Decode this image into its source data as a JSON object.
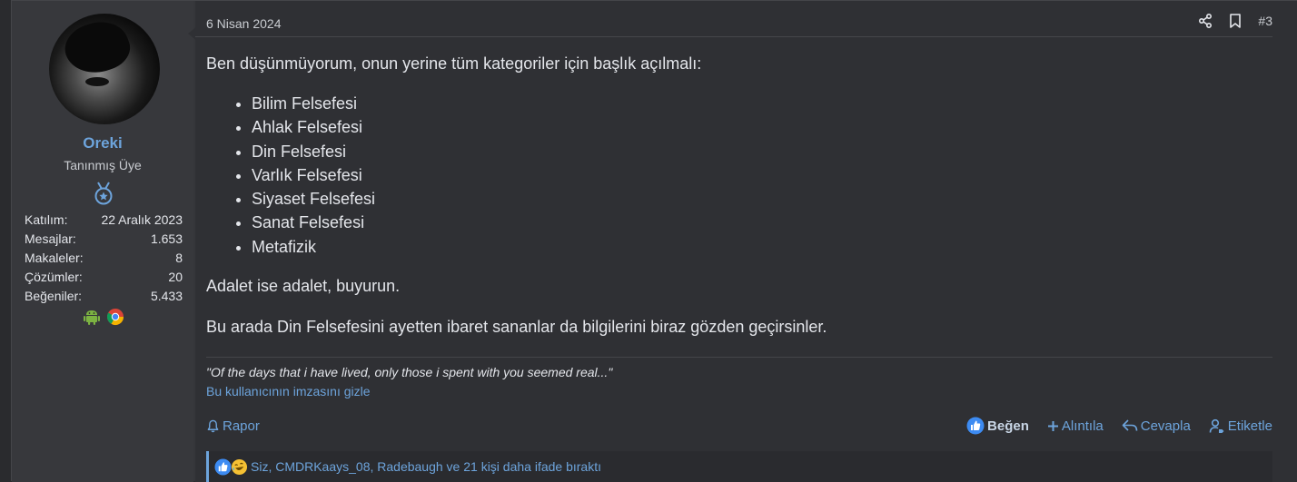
{
  "user": {
    "name": "Oreki",
    "title": "Tanınmış Üye",
    "stats": [
      {
        "label": "Katılım:",
        "value": "22 Aralık 2023"
      },
      {
        "label": "Mesajlar:",
        "value": "1.653"
      },
      {
        "label": "Makaleler:",
        "value": "8"
      },
      {
        "label": "Çözümler:",
        "value": "20"
      },
      {
        "label": "Beğeniler:",
        "value": "5.433"
      }
    ],
    "device_icons": [
      "android-icon",
      "chrome-icon"
    ]
  },
  "post": {
    "date": "6 Nisan 2024",
    "number": "#3",
    "intro": "Ben düşünmüyorum, onun yerine tüm kategoriler için başlık açılmalı:",
    "list": [
      "Bilim Felsefesi",
      "Ahlak Felsefesi",
      "Din Felsefesi",
      "Varlık Felsefesi",
      "Siyaset Felsefesi",
      "Sanat Felsefesi",
      "Metafizik"
    ],
    "para1": "Adalet ise adalet, buyurun.",
    "para2": "Bu arada Din Felsefesini ayetten ibaret sananlar da bilgilerini biraz gözden geçirsinler."
  },
  "signature": {
    "quote": "\"Of the days that i have lived, only those i spent with you seemed real...\"",
    "hide_link": "Bu kullanıcının imzasını gizle"
  },
  "actions": {
    "report": "Rapor",
    "like": "Beğen",
    "quote": "Alıntıla",
    "reply": "Cevapla",
    "tag": "Etiketle"
  },
  "reactions": {
    "text": "Siz, CMDRKaays_08, Radebaugh ve 21 kişi daha ifade bıraktı"
  },
  "colors": {
    "accent": "#6da4dc",
    "background": "#2f3034"
  }
}
